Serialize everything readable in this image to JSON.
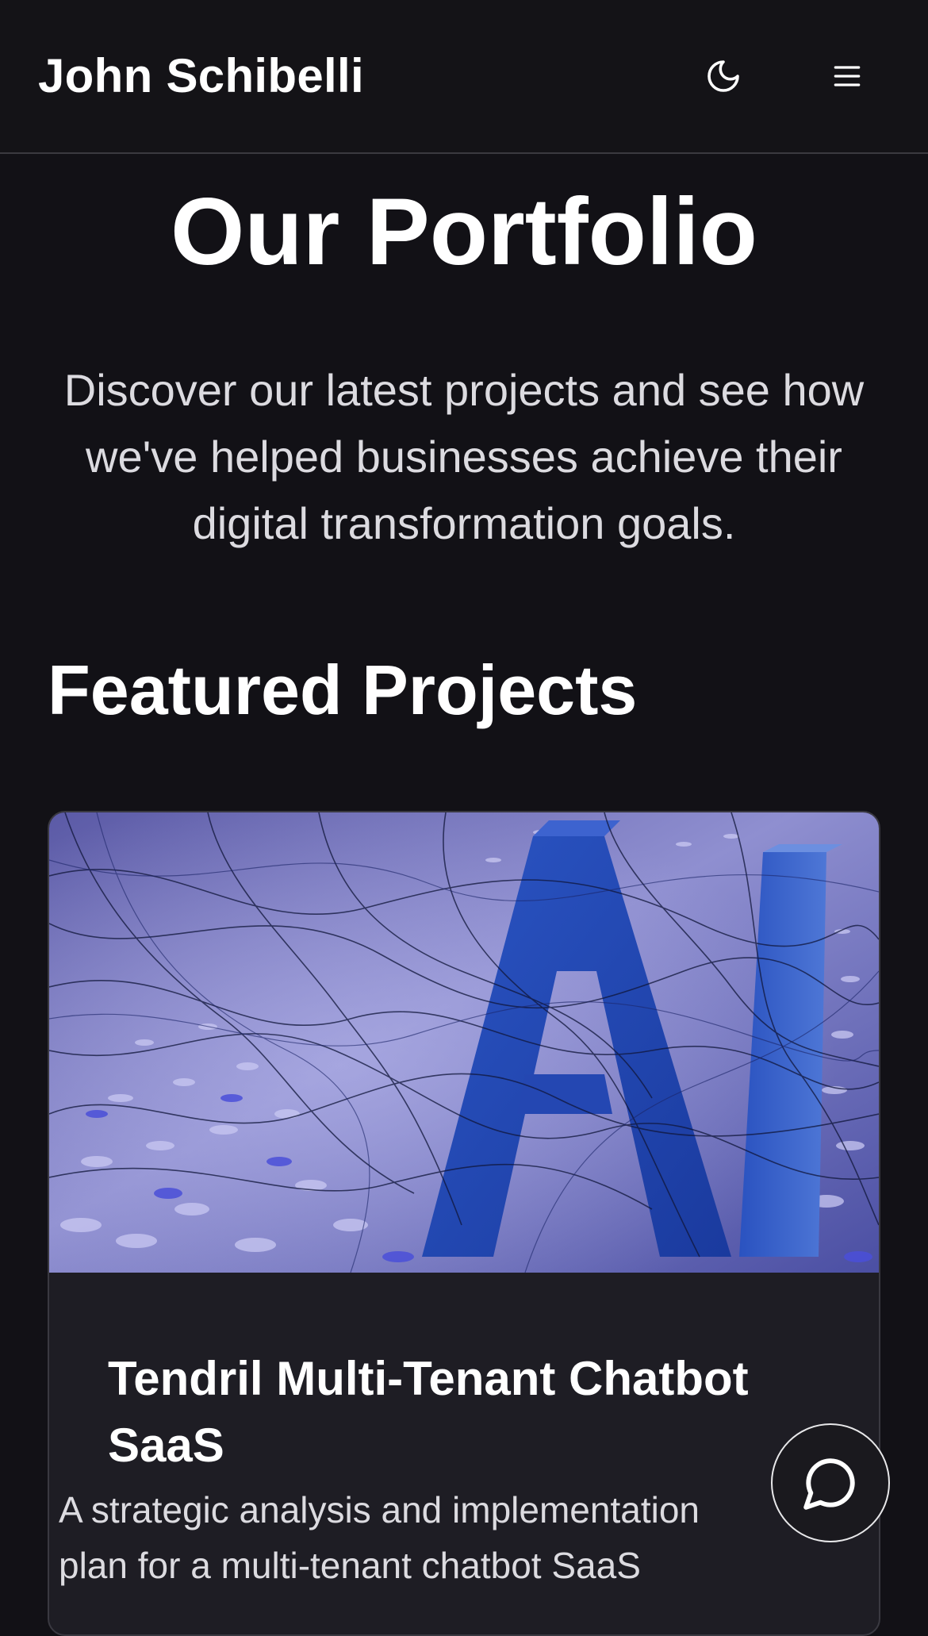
{
  "header": {
    "brand": "John Schibelli",
    "theme_toggle_icon": "moon-icon",
    "menu_icon": "hamburger-menu-icon"
  },
  "hero": {
    "title": "Our Portfolio",
    "subtitle": "Discover our latest projects and see how we've helped businesses achieve their digital transformation goals."
  },
  "featured": {
    "title": "Featured Projects",
    "projects": [
      {
        "title": "Tendril Multi-Tenant Chatbot SaaS",
        "description": "A strategic analysis and implementation plan for a multi-tenant chatbot SaaS",
        "image_icon": "ai-letters-image"
      }
    ]
  },
  "chat": {
    "icon": "chat-bubble-icon"
  },
  "colors": {
    "background": "#121116",
    "header_background": "#141317",
    "card_background": "#1e1d24",
    "text_primary": "#ffffff",
    "text_secondary": "#dcdbe0"
  }
}
